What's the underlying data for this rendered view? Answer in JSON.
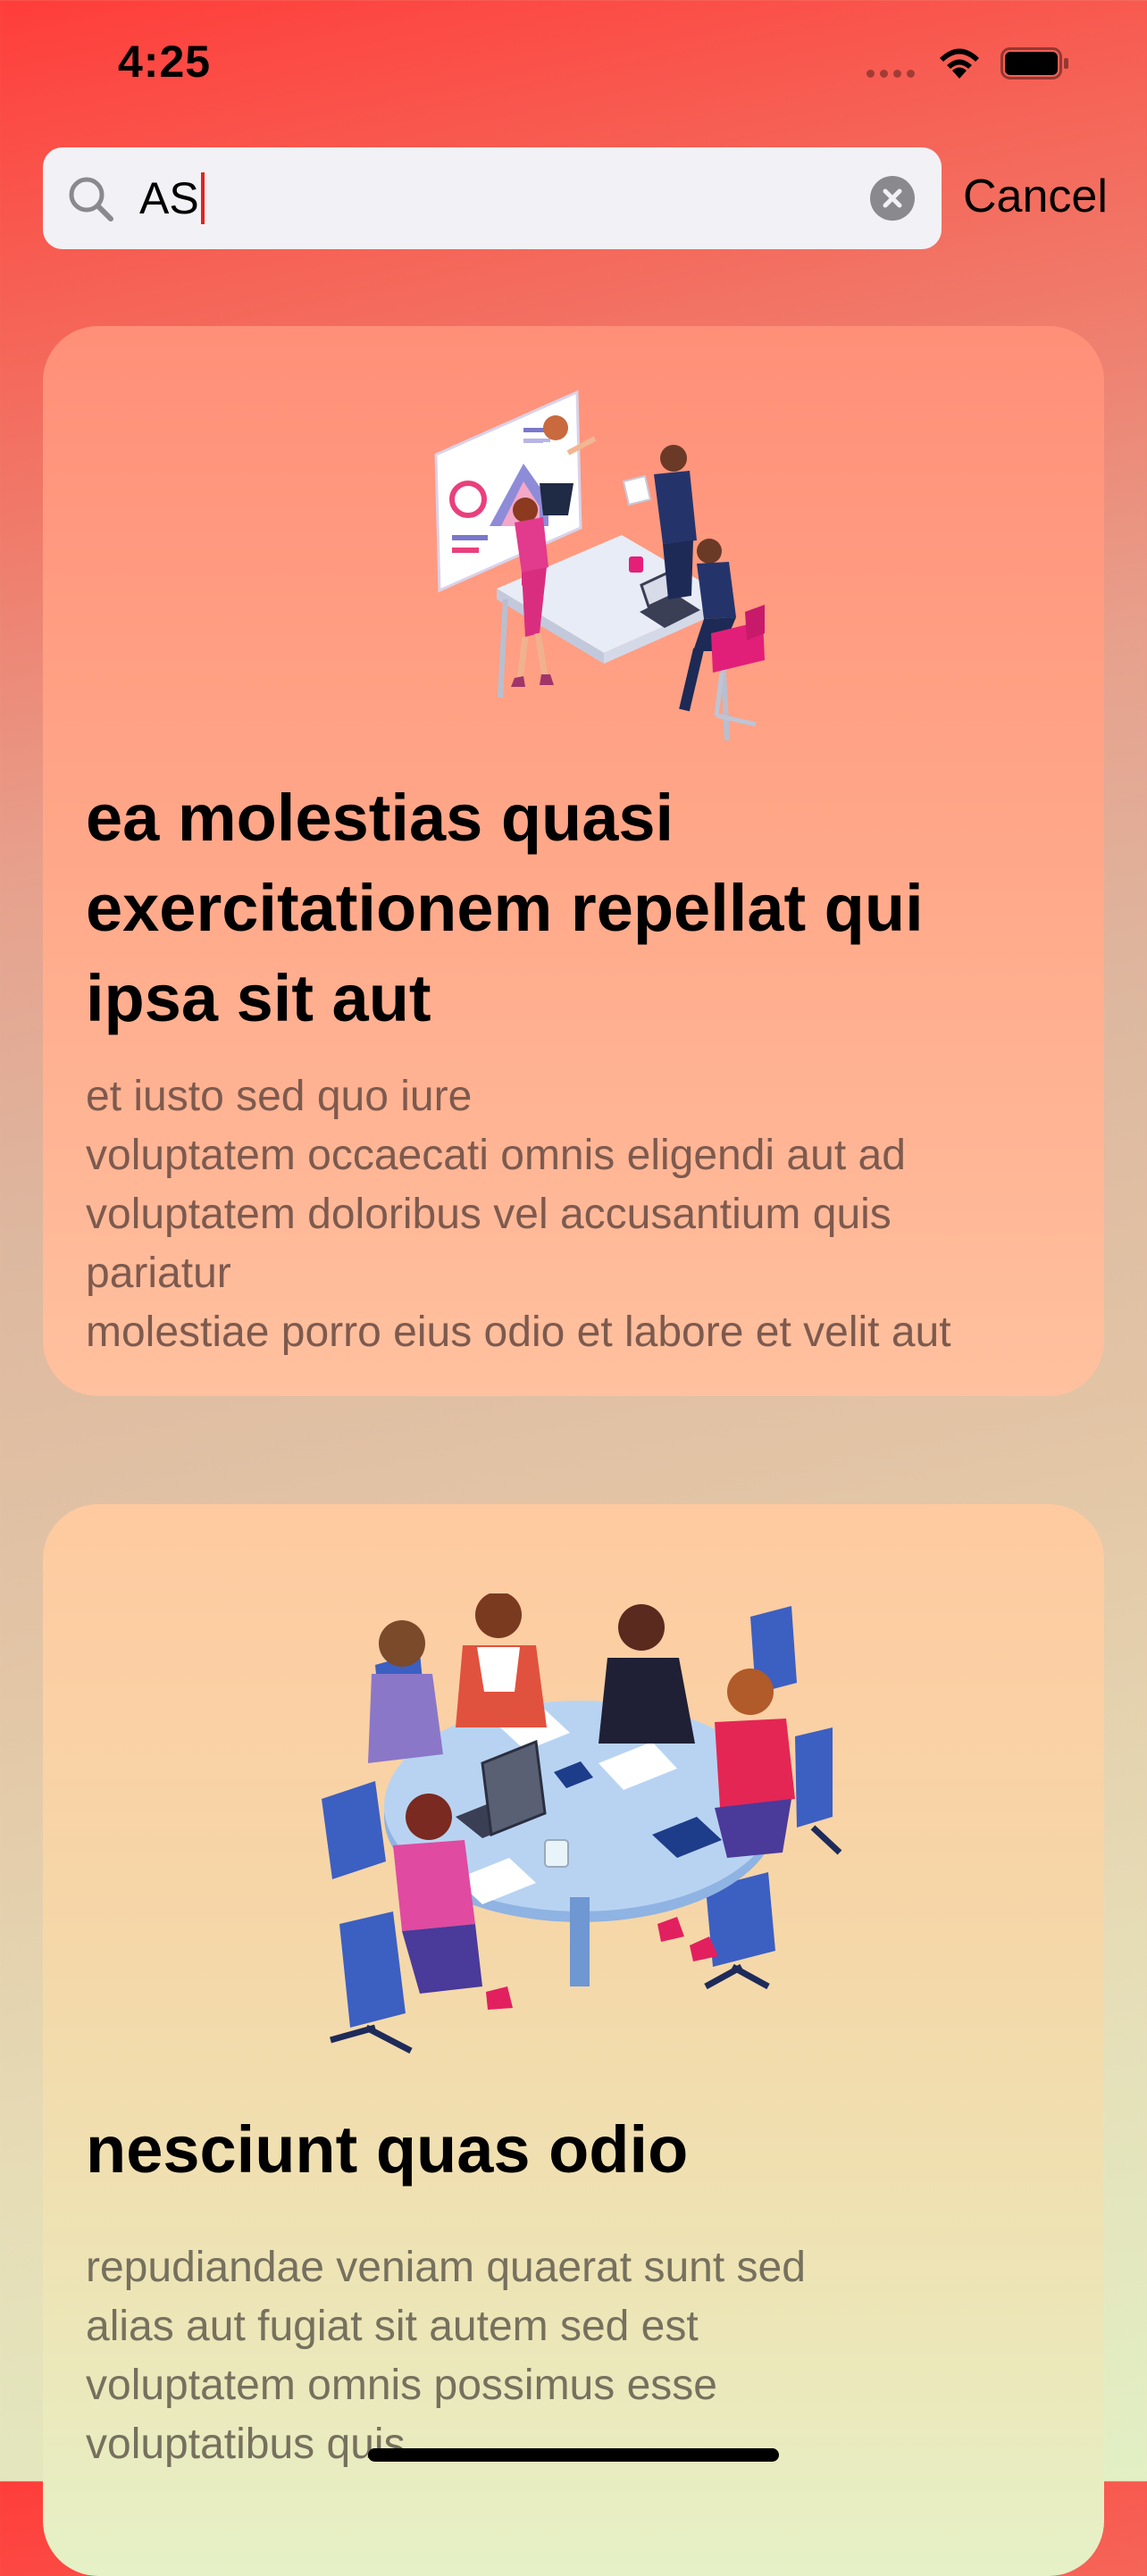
{
  "status_bar": {
    "time": "4:25"
  },
  "search": {
    "query": "AS",
    "cancel_label": "Cancel"
  },
  "cards": [
    {
      "title_lines": [
        "ea molestias quasi",
        "exercitationem repellat qui",
        "ipsa sit aut"
      ],
      "description_lines": [
        "et iusto sed quo iure",
        "voluptatem occaecati omnis eligendi aut ad",
        "voluptatem doloribus vel accusantium quis",
        "pariatur",
        "molestiae porro eius odio et labore et velit aut"
      ]
    },
    {
      "title_lines": [
        "nesciunt quas odio"
      ],
      "description_lines": [
        "repudiandae veniam quaerat sunt sed",
        "alias aut fugiat sit autem sed est",
        "voluptatem omnis possimus esse",
        "voluptatibus quis"
      ]
    }
  ],
  "colors": {
    "caret": "#e0251f",
    "background_top": "#ff3d3a",
    "background_bottom": "#e2f0c4"
  },
  "icons": {
    "search": "magnifying-glass",
    "clear": "x-circle-filled",
    "wifi": "wifi",
    "battery": "battery-full"
  }
}
